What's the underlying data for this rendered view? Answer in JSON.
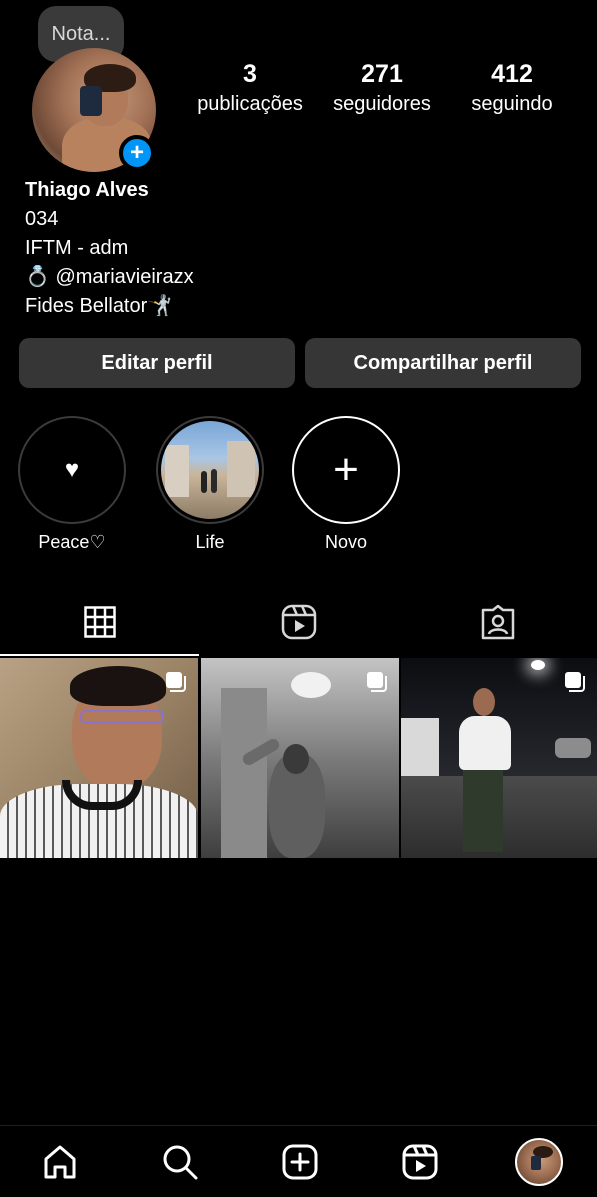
{
  "note": {
    "text": "Nota..."
  },
  "profile": {
    "stats": [
      {
        "value": "3",
        "label": "publicações"
      },
      {
        "value": "271",
        "label": "seguidores"
      },
      {
        "value": "412",
        "label": "seguindo"
      }
    ],
    "name": "Thiago Alves",
    "bio": [
      "034",
      "IFTM - adm",
      "💍 @mariavieirazx",
      "Fides Bellator🤺"
    ]
  },
  "buttons": {
    "edit_profile": "Editar perfil",
    "share_profile": "Compartilhar perfil"
  },
  "highlights": [
    {
      "label": "Peace♡",
      "icon": "♥"
    },
    {
      "label": "Life"
    },
    {
      "label": "Novo",
      "icon": "+"
    }
  ],
  "colors": {
    "background": "#000000",
    "button": "#363636",
    "accent": "#0095f6"
  },
  "tabs": [
    {
      "name": "grid-icon",
      "active": true
    },
    {
      "name": "reels-icon",
      "active": false
    },
    {
      "name": "tagged-icon",
      "active": false
    }
  ],
  "posts": [
    {
      "icon": "multiple-photos-icon"
    },
    {
      "icon": "multiple-photos-icon"
    },
    {
      "icon": "multiple-photos-icon"
    }
  ],
  "bottom_nav": [
    {
      "name": "home-icon"
    },
    {
      "name": "search-icon"
    },
    {
      "name": "create-icon"
    },
    {
      "name": "reels-icon"
    },
    {
      "name": "profile-avatar"
    }
  ]
}
